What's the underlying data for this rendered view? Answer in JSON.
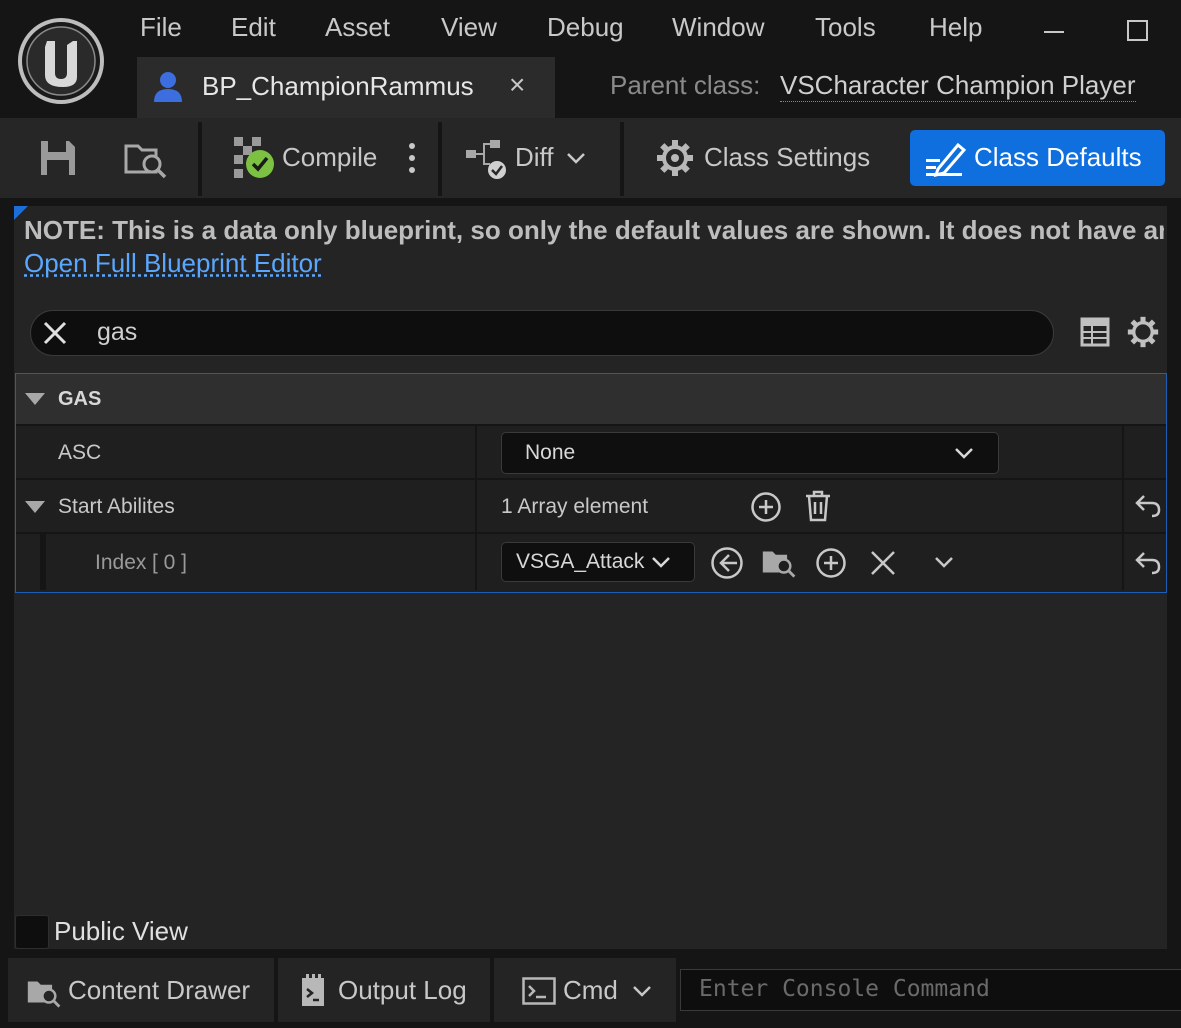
{
  "menu": [
    "File",
    "Edit",
    "Asset",
    "View",
    "Debug",
    "Window",
    "Tools",
    "Help"
  ],
  "tab": {
    "label": "BP_ChampionRammus",
    "close": "×"
  },
  "parent_class": {
    "label": "Parent class:",
    "value": "VSCharacter Champion Player"
  },
  "toolbar": {
    "compile_label": "Compile",
    "diff_label": "Diff",
    "class_settings_label": "Class Settings",
    "class_defaults_label": "Class Defaults"
  },
  "note": "NOTE: This is a data only blueprint, so only the default values are shown.  It does not have any",
  "open_full_editor": "Open Full Blueprint Editor",
  "search": {
    "value": "gas"
  },
  "details": {
    "category": "GAS",
    "asc": {
      "label": "ASC",
      "value": "None"
    },
    "start_abilities": {
      "label": "Start Abilites",
      "summary": "1 Array element"
    },
    "index_row": {
      "label": "Index",
      "index_text": "[ 0 ]",
      "value": "VSGA_Attack"
    }
  },
  "public_view_label": "Public View",
  "statusbar": {
    "content_drawer": "Content Drawer",
    "output_log": "Output Log",
    "cmd": "Cmd",
    "console_placeholder": "Enter Console Command"
  },
  "icons": {
    "logo": "unreal-logo",
    "tab": "character-icon",
    "save": "save-icon",
    "browse": "browse-icon",
    "compile": "compile-check-icon",
    "diff": "diff-icon",
    "settings": "gear-icon",
    "defaults": "edit-pencil-icon"
  },
  "colors": {
    "accent": "#0f6fde",
    "link": "#5aa7ff",
    "compile_ok": "#7cc142"
  }
}
